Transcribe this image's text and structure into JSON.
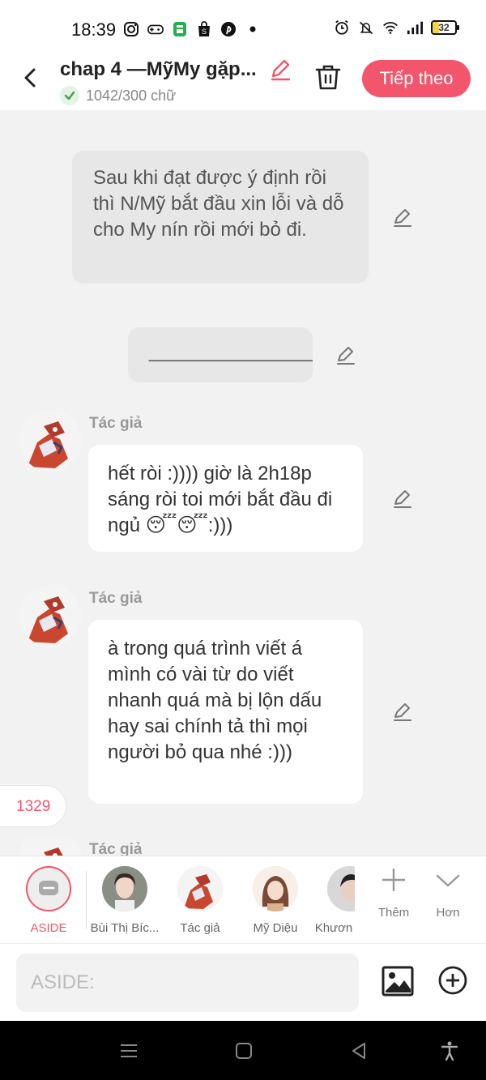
{
  "status_bar": {
    "time": "18:39",
    "battery": "32"
  },
  "header": {
    "title": "chap 4 —MỹMy gặp...",
    "word_count": "1042/300 chữ",
    "next_label": "Tiếp theo"
  },
  "messages": [
    {
      "type": "narration",
      "text": "Sau khi đạt được ý định rồi thì N/Mỹ bắt đầu xin lỗi và dỗ cho My nín rồi mới bỏ đi."
    },
    {
      "type": "narration",
      "text": "________________"
    },
    {
      "type": "character",
      "speaker": "Tác giả",
      "text": "hết ròi :)))) giờ là 2h18p sáng ròi toi mới bắt đầu đi ngủ 😴😴:)))"
    },
    {
      "type": "character",
      "speaker": "Tác giả",
      "text": "à trong quá trình viết á mình có vài từ do viết nhanh quá mà bị lộn dấu hay sai chính tả thì mọi người bỏ qua nhé :)))"
    },
    {
      "type": "character",
      "speaker": "Tác giả",
      "text": ""
    }
  ],
  "counter": "1329",
  "characters": [
    {
      "label": "ASIDE",
      "active": true
    },
    {
      "label": "Bùi Thị Bíc..."
    },
    {
      "label": "Tác giả"
    },
    {
      "label": "Mỹ Diệu"
    },
    {
      "label": "Khươn"
    }
  ],
  "tools": {
    "more_label": "Thêm",
    "collapse_label": "Hơn"
  },
  "input": {
    "placeholder": "ASIDE:"
  },
  "colors": {
    "accent": "#f3566c",
    "narration_bubble": "#e7e7e7",
    "author_bubble": "#ffffff",
    "background": "#f2f2f2"
  }
}
